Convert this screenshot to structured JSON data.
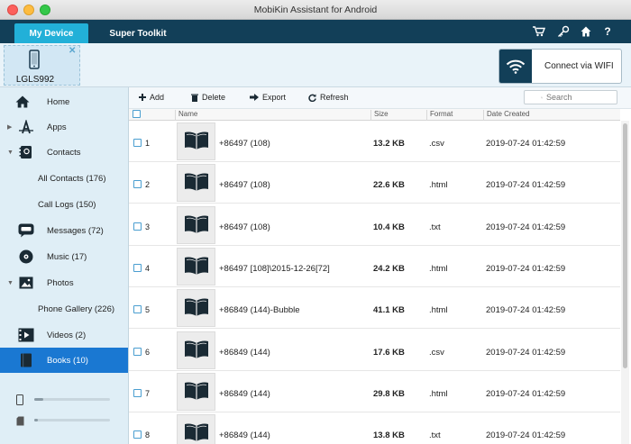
{
  "window": {
    "title": "MobiKin Assistant for Android"
  },
  "nav": {
    "tabs": [
      {
        "label": "My Device",
        "active": true
      },
      {
        "label": "Super Toolkit",
        "active": false
      }
    ],
    "icons": [
      "cart-icon",
      "key-icon",
      "home-icon",
      "help-icon"
    ]
  },
  "device": {
    "name": "LGLS992",
    "close_glyph": "✕"
  },
  "wifi_button": {
    "label": "Connect via WIFI"
  },
  "sidebar": {
    "items": [
      {
        "label": "Home",
        "icon": "home-icon"
      },
      {
        "label": "Apps",
        "icon": "apps-icon",
        "caret": "▶"
      },
      {
        "label": "Contacts",
        "icon": "contacts-icon",
        "caret": "▼"
      },
      {
        "label": "All Contacts (176)",
        "sub": true
      },
      {
        "label": "Call Logs (150)",
        "sub": true
      },
      {
        "label": "Messages (72)",
        "icon": "messages-icon"
      },
      {
        "label": "Music (17)",
        "icon": "music-icon"
      },
      {
        "label": "Photos",
        "icon": "photos-icon",
        "caret": "▼"
      },
      {
        "label": "Phone Gallery (226)",
        "sub": true
      },
      {
        "label": "Videos (2)",
        "icon": "videos-icon"
      },
      {
        "label": "Books (10)",
        "icon": "books-icon",
        "active": true
      }
    ],
    "storage": [
      {
        "icon": "phone-storage-icon",
        "fill": 0.12
      },
      {
        "icon": "sd-card-icon",
        "fill": 0.05
      }
    ]
  },
  "toolbar": {
    "add": "Add",
    "delete": "Delete",
    "export": "Export",
    "refresh": "Refresh",
    "search_placeholder": "Search"
  },
  "table": {
    "columns": [
      "Name",
      "Size",
      "Format",
      "Date Created"
    ],
    "rows": [
      {
        "idx": "1",
        "name": "+86497 (108)",
        "size": "13.2 KB",
        "format": ".csv",
        "date": "2019-07-24 01:42:59"
      },
      {
        "idx": "2",
        "name": "+86497 (108)",
        "size": "22.6 KB",
        "format": ".html",
        "date": "2019-07-24 01:42:59"
      },
      {
        "idx": "3",
        "name": "+86497 (108)",
        "size": "10.4 KB",
        "format": ".txt",
        "date": "2019-07-24 01:42:59"
      },
      {
        "idx": "4",
        "name": "+86497 [108]\\2015-12-26[72]",
        "size": "24.2 KB",
        "format": ".html",
        "date": "2019-07-24 01:42:59"
      },
      {
        "idx": "5",
        "name": "+86849 (144)-Bubble",
        "size": "41.1 KB",
        "format": ".html",
        "date": "2019-07-24 01:42:59"
      },
      {
        "idx": "6",
        "name": "+86849 (144)",
        "size": "17.6 KB",
        "format": ".csv",
        "date": "2019-07-24 01:42:59"
      },
      {
        "idx": "7",
        "name": "+86849 (144)",
        "size": "29.8 KB",
        "format": ".html",
        "date": "2019-07-24 01:42:59"
      },
      {
        "idx": "8",
        "name": "+86849 (144)",
        "size": "13.8 KB",
        "format": ".txt",
        "date": "2019-07-24 01:42:59"
      }
    ]
  },
  "colors": {
    "nav_bg": "#123f58",
    "tab_active": "#22b0d8",
    "sidebar_active": "#1a78d2",
    "checkbox_border": "#4a9ed0"
  }
}
